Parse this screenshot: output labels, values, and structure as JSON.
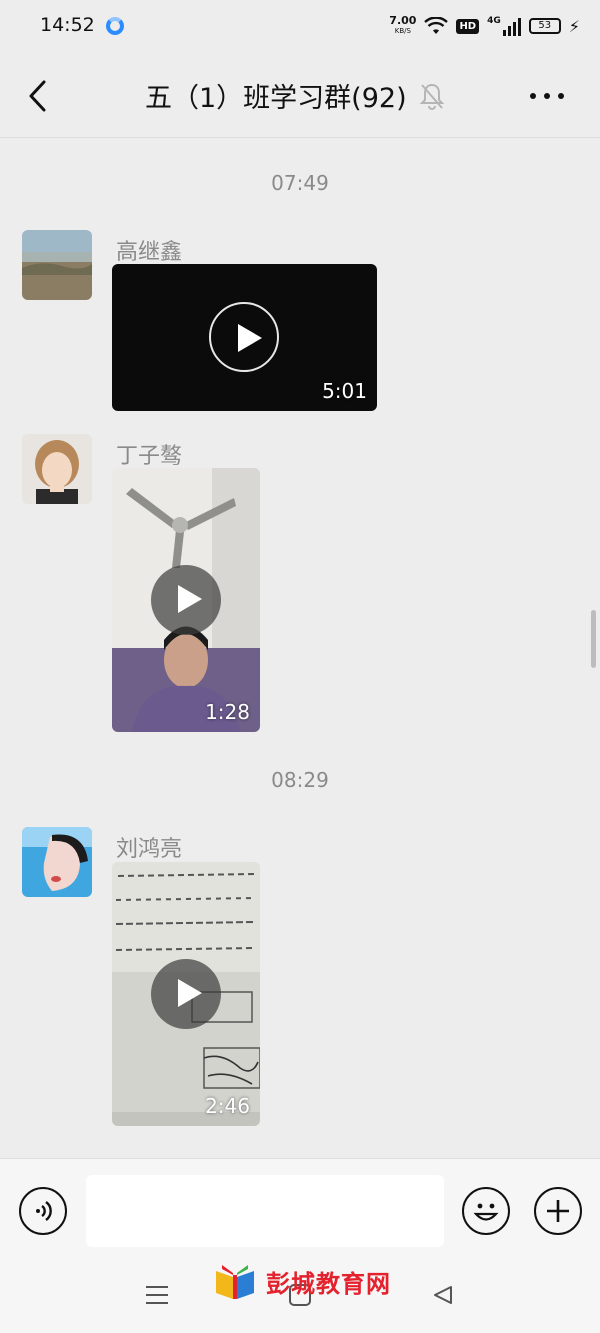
{
  "status_bar": {
    "time": "14:52",
    "net_speed_value": "7.00",
    "net_speed_unit": "KB/S",
    "hd_label": "HD",
    "network_type": "4G",
    "battery_level": "53"
  },
  "header": {
    "title": "五（1）班学习群(92)",
    "back_icon": "chevron-left-icon",
    "mute_icon": "bell-muted-icon",
    "more_icon": "more-dots-icon"
  },
  "messages": [
    {
      "timestamp": "07:49",
      "sender": "高继鑫",
      "type": "video",
      "duration": "5:01"
    },
    {
      "sender": "丁子骜",
      "type": "video",
      "duration": "1:28"
    },
    {
      "timestamp": "08:29",
      "sender": "刘鸿亮",
      "type": "video",
      "duration": "2:46"
    }
  ],
  "input_bar": {
    "voice_icon": "voice-icon",
    "emoji_icon": "emoji-icon",
    "plus_icon": "plus-icon",
    "placeholder": ""
  },
  "watermark": {
    "text": "彭城教育网"
  },
  "colors": {
    "background": "#ededed",
    "accent_red": "#e4222e"
  }
}
